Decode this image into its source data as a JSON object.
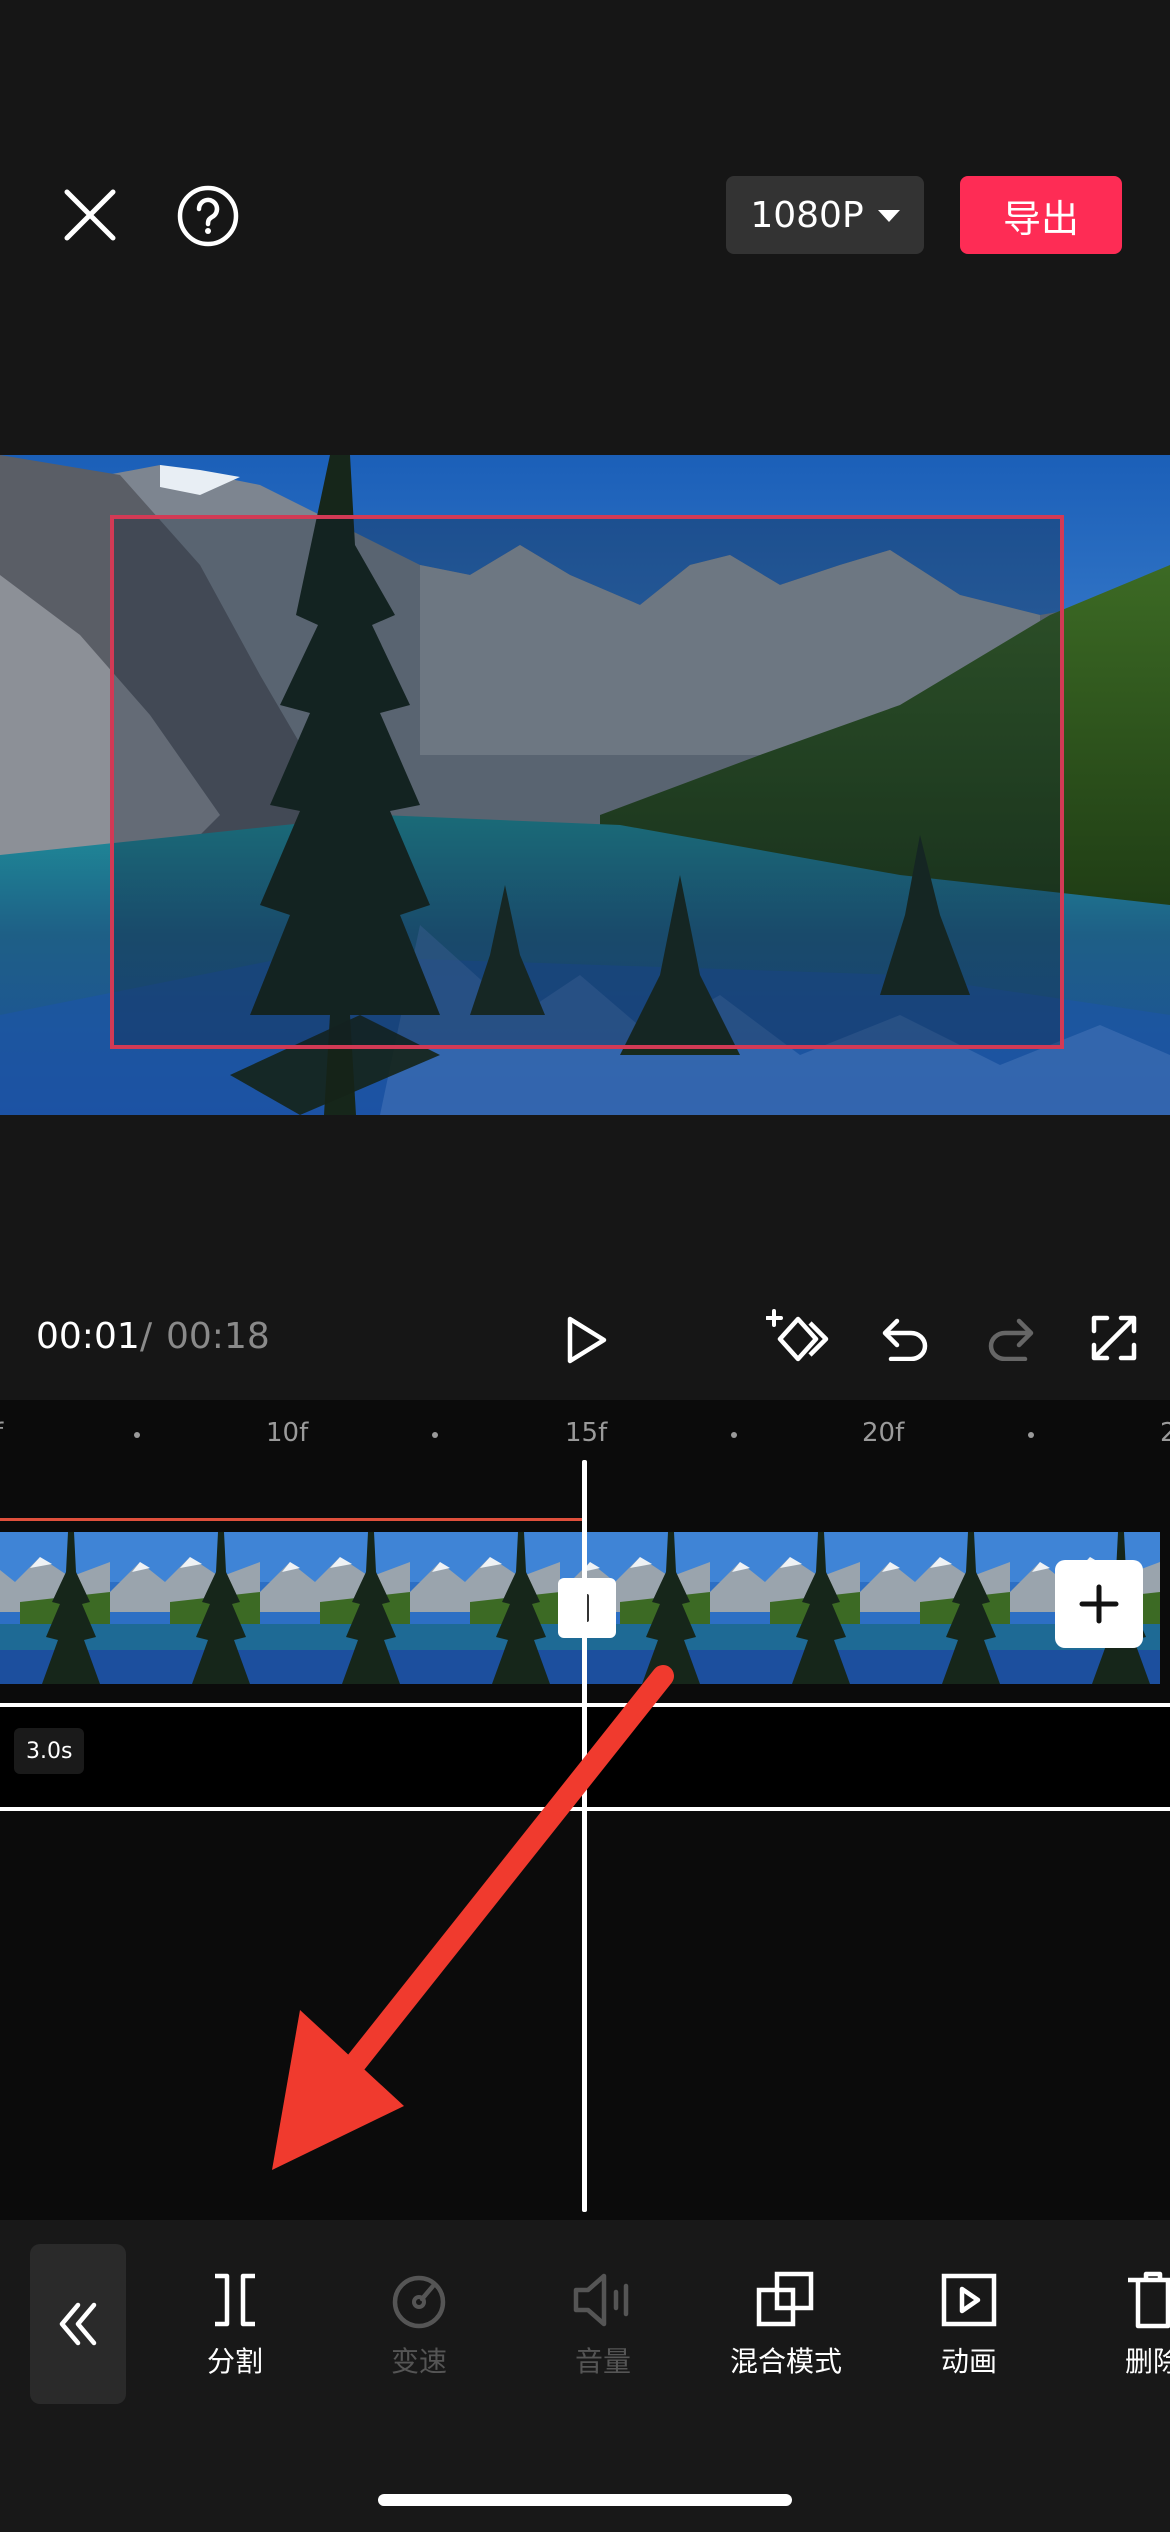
{
  "header": {
    "close_icon": "close-icon",
    "help_icon": "help-icon",
    "resolution_label": "1080P",
    "export_label": "导出",
    "colors": {
      "export": "#fe2c55",
      "resolution_bg": "#333333"
    }
  },
  "player": {
    "current_time": "00:01",
    "separator": "/",
    "total_time": "00:18",
    "icons": [
      "play-icon",
      "add-keyframe-icon",
      "undo-icon",
      "redo-icon",
      "fullscreen-icon"
    ]
  },
  "timeline": {
    "ruler_labels": [
      "f",
      "10f",
      "15f",
      "20f",
      "2"
    ],
    "clip_duration": "3.0s",
    "add_clip_icon": "plus-icon"
  },
  "toolbar": {
    "back_icon": "double-chevron-left-icon",
    "items": [
      {
        "label": "分割",
        "icon": "split-icon",
        "enabled": true
      },
      {
        "label": "变速",
        "icon": "speed-icon",
        "enabled": false
      },
      {
        "label": "音量",
        "icon": "volume-icon",
        "enabled": false
      },
      {
        "label": "混合模式",
        "icon": "blend-mode-icon",
        "enabled": true
      },
      {
        "label": "动画",
        "icon": "animation-icon",
        "enabled": true
      },
      {
        "label": "删除",
        "icon": "delete-icon",
        "enabled": true
      }
    ]
  },
  "annotation": {
    "arrow_color": "#f03a2e"
  }
}
